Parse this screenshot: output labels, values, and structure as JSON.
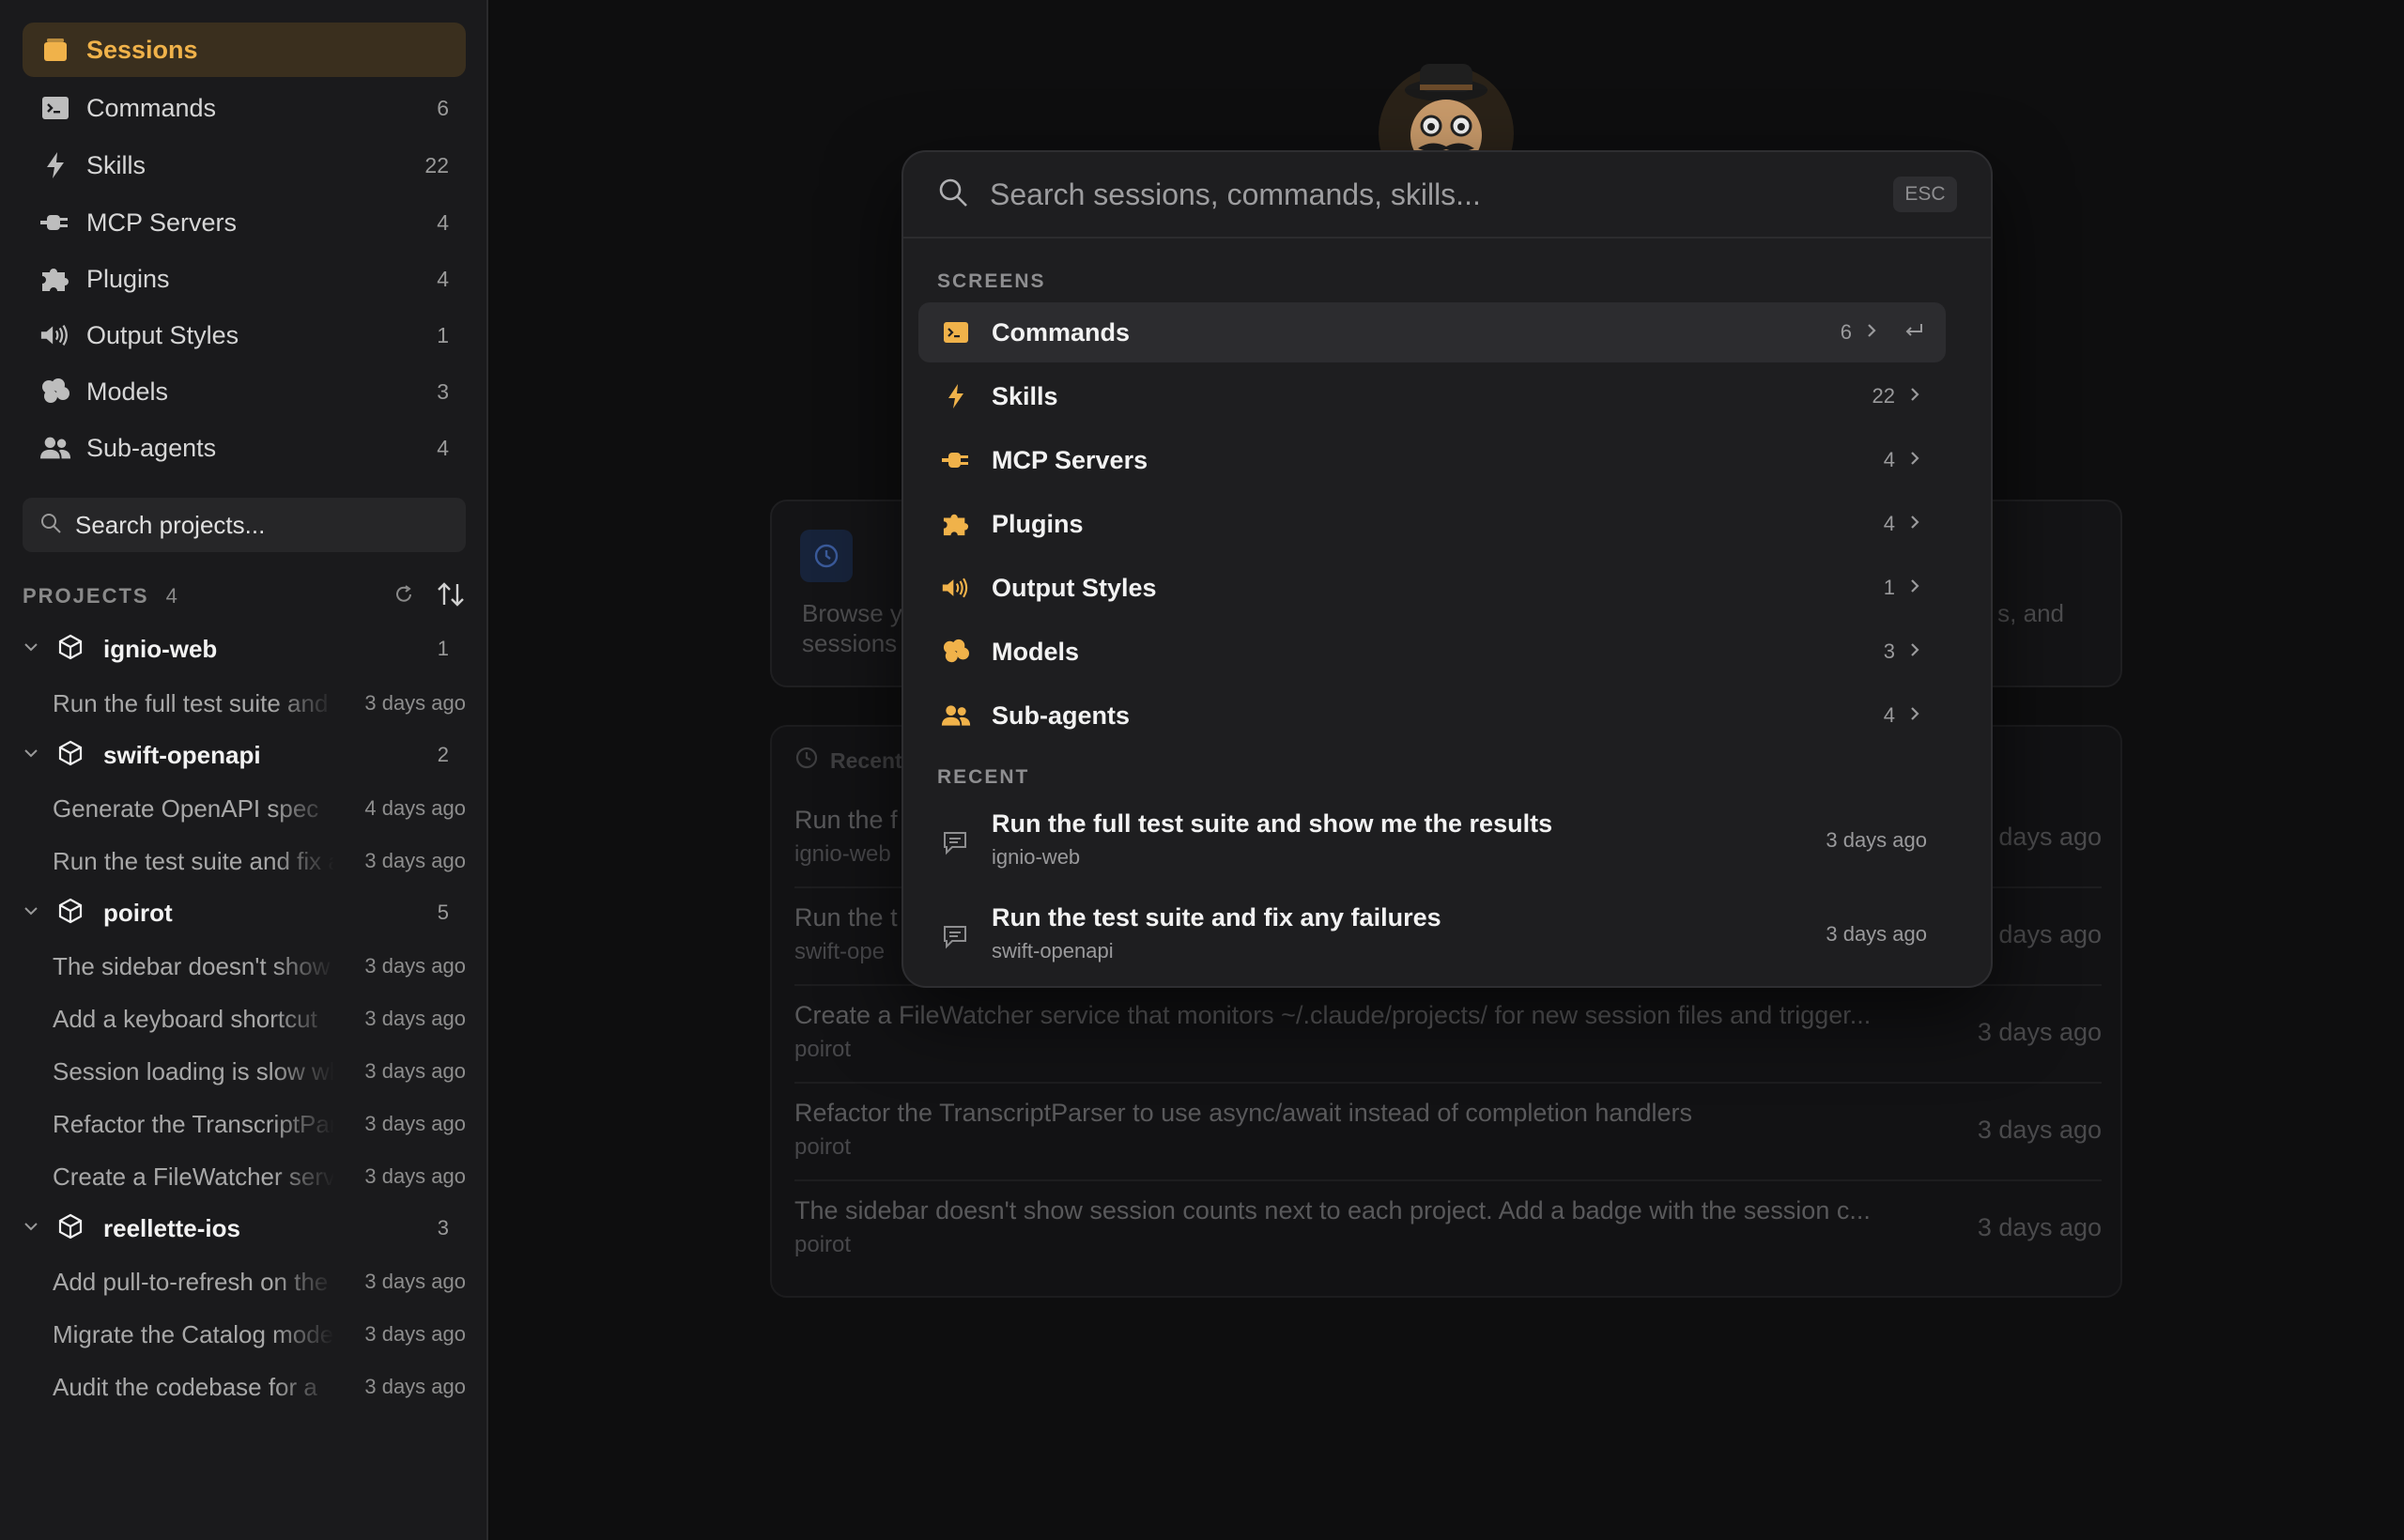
{
  "sidebar": {
    "nav": [
      {
        "label": "Sessions",
        "count": "",
        "icon": "sessions-icon"
      },
      {
        "label": "Commands",
        "count": "6",
        "icon": "terminal-icon"
      },
      {
        "label": "Skills",
        "count": "22",
        "icon": "bolt-icon"
      },
      {
        "label": "MCP Servers",
        "count": "4",
        "icon": "plug-icon"
      },
      {
        "label": "Plugins",
        "count": "4",
        "icon": "puzzle-icon"
      },
      {
        "label": "Output Styles",
        "count": "1",
        "icon": "speaker-icon"
      },
      {
        "label": "Models",
        "count": "3",
        "icon": "brain-icon"
      },
      {
        "label": "Sub-agents",
        "count": "4",
        "icon": "people-icon"
      }
    ],
    "search_placeholder": "Search projects...",
    "projects_title": "PROJECTS",
    "projects_count": "4",
    "projects": [
      {
        "name": "ignio-web",
        "count": "1",
        "sessions": [
          {
            "text": "Run the full test suite and show me the results",
            "time": "3 days ago"
          }
        ]
      },
      {
        "name": "swift-openapi",
        "count": "2",
        "sessions": [
          {
            "text": "Generate OpenAPI spec",
            "time": "4 days ago"
          },
          {
            "text": "Run the test suite and fix any failures",
            "time": "3 days ago"
          }
        ]
      },
      {
        "name": "poirot",
        "count": "5",
        "sessions": [
          {
            "text": "The sidebar doesn't show session counts",
            "time": "3 days ago"
          },
          {
            "text": "Add a keyboard shortcut",
            "time": "3 days ago"
          },
          {
            "text": "Session loading is slow when",
            "time": "3 days ago"
          },
          {
            "text": "Refactor the TranscriptParser",
            "time": "3 days ago"
          },
          {
            "text": "Create a FileWatcher service",
            "time": "3 days ago"
          }
        ]
      },
      {
        "name": "reellette-ios",
        "count": "3",
        "sessions": [
          {
            "text": "Add pull-to-refresh on the",
            "time": "3 days ago"
          },
          {
            "text": "Migrate the Catalog model",
            "time": "3 days ago"
          },
          {
            "text": "Audit the codebase for a",
            "time": "3 days ago"
          }
        ]
      }
    ]
  },
  "background": {
    "card_text_1": "Browse y",
    "card_text_2": "sessions",
    "card_text_3": "s, and",
    "recent_title": "Recent",
    "rows": [
      {
        "prompt": "Run the f",
        "project": "ignio-web",
        "time": "days ago"
      },
      {
        "prompt": "Run the t",
        "project": "swift-ope",
        "time": "days ago"
      },
      {
        "prompt": "Create a FileWatcher service that monitors ~/.claude/projects/ for new session files and trigger...",
        "project": "poirot",
        "time": "3 days ago"
      },
      {
        "prompt": "Refactor the TranscriptParser to use async/await instead of completion handlers",
        "project": "poirot",
        "time": "3 days ago"
      },
      {
        "prompt": "The sidebar doesn't show session counts next to each project. Add a badge with the session c...",
        "project": "poirot",
        "time": "3 days ago"
      }
    ]
  },
  "palette": {
    "search_placeholder": "Search sessions, commands, skills...",
    "esc_label": "ESC",
    "screens_title": "SCREENS",
    "screens": [
      {
        "label": "Commands",
        "count": "6",
        "icon": "terminal-icon"
      },
      {
        "label": "Skills",
        "count": "22",
        "icon": "bolt-icon"
      },
      {
        "label": "MCP Servers",
        "count": "4",
        "icon": "plug-icon"
      },
      {
        "label": "Plugins",
        "count": "4",
        "icon": "puzzle-icon"
      },
      {
        "label": "Output Styles",
        "count": "1",
        "icon": "speaker-icon"
      },
      {
        "label": "Models",
        "count": "3",
        "icon": "brain-icon"
      },
      {
        "label": "Sub-agents",
        "count": "4",
        "icon": "people-icon"
      }
    ],
    "recent_title": "RECENT",
    "recent": [
      {
        "title": "Run the full test suite and show me the results",
        "project": "ignio-web",
        "time": "3 days ago"
      },
      {
        "title": "Run the test suite and fix any failures",
        "project": "swift-openapi",
        "time": "3 days ago"
      }
    ]
  },
  "colors": {
    "accent": "#f0b24a",
    "active_bg": "#3a2f1e",
    "sidebar_bg": "#1a1a1c",
    "palette_bg": "#1e1e20"
  }
}
